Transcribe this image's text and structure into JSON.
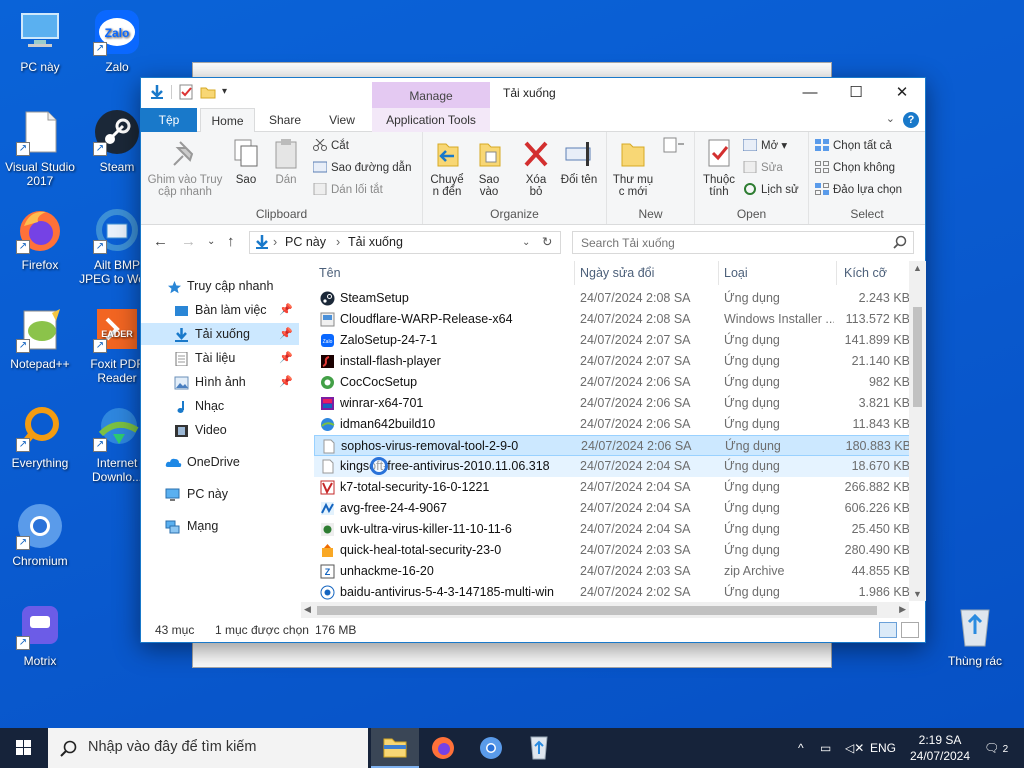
{
  "desktop": {
    "icons": [
      {
        "label": "PC này",
        "icon": "pc-icon"
      },
      {
        "label": "Zalo",
        "icon": "zalo-icon"
      },
      {
        "label": "Visual Studio 2017",
        "icon": "file-icon"
      },
      {
        "label": "Steam",
        "icon": "steam-icon"
      },
      {
        "label": "Firefox",
        "icon": "firefox-icon"
      },
      {
        "label": "Ailt BMP JPEG to Wo...",
        "icon": "converter-icon"
      },
      {
        "label": "Notepad++",
        "icon": "notepadpp-icon"
      },
      {
        "label": "Foxit PDF Reader",
        "icon": "foxit-icon"
      },
      {
        "label": "Everything",
        "icon": "everything-icon"
      },
      {
        "label": "Internet Downlo...",
        "icon": "idm-icon"
      },
      {
        "label": "Chromium",
        "icon": "chromium-icon"
      },
      {
        "label": "Motrix",
        "icon": "motrix-icon"
      },
      {
        "label": "Thùng rác",
        "icon": "recycle-bin-icon"
      }
    ]
  },
  "window": {
    "title": "Tải xuống",
    "manage_label": "Manage",
    "tabs": {
      "file": "Tệp",
      "home": "Home",
      "share": "Share",
      "view": "View",
      "app_tools": "Application Tools"
    },
    "ribbon": {
      "clipboard": {
        "pin": "Ghim vào Truy cập nhanh",
        "copy": "Sao",
        "paste": "Dán",
        "cut": "Cắt",
        "copy_path": "Sao đường dẫn",
        "paste_shortcut": "Dán lối tắt",
        "label": "Clipboard"
      },
      "organize": {
        "move": "Chuyể n đến",
        "copy_to": "Sao vào",
        "delete": "Xóa bỏ",
        "rename": "Đổi tên",
        "label": "Organize"
      },
      "new": {
        "folder": "Thư mụ c mới",
        "label": "New"
      },
      "open": {
        "properties": "Thuộc tính",
        "open": "Mở",
        "edit": "Sửa",
        "history": "Lịch sử",
        "label": "Open"
      },
      "select": {
        "all": "Chọn tất cả",
        "none": "Chọn không",
        "invert": "Đảo lựa chọn",
        "label": "Select"
      }
    },
    "address": {
      "crumbs": [
        "PC này",
        "Tải xuống"
      ],
      "search_placeholder": "Search Tải xuống"
    },
    "nav": [
      {
        "label": "Truy cập nhanh",
        "icon": "star-icon",
        "pinned": false
      },
      {
        "label": "Bàn làm việc",
        "icon": "desktop-icon",
        "pinned": true
      },
      {
        "label": "Tải xuống",
        "icon": "download-icon",
        "pinned": true
      },
      {
        "label": "Tài liệu",
        "icon": "document-icon",
        "pinned": true
      },
      {
        "label": "Hình ảnh",
        "icon": "picture-icon",
        "pinned": true
      },
      {
        "label": "Nhạc",
        "icon": "music-icon",
        "pinned": false
      },
      {
        "label": "Video",
        "icon": "video-icon",
        "pinned": false
      },
      {
        "label": "OneDrive",
        "icon": "cloud-icon",
        "pinned": false
      },
      {
        "label": "PC này",
        "icon": "pc-icon",
        "pinned": false
      },
      {
        "label": "Mạng",
        "icon": "network-icon",
        "pinned": false
      }
    ],
    "columns": {
      "name": "Tên",
      "date": "Ngày sửa đổi",
      "type": "Loại",
      "size": "Kích cỡ"
    },
    "files": [
      {
        "name": "SteamSetup",
        "date": "24/07/2024 2:08 SA",
        "type": "Ứng dụng",
        "size": "2.243 KB",
        "icon": "steam-icon"
      },
      {
        "name": "Cloudflare-WARP-Release-x64",
        "date": "24/07/2024 2:08 SA",
        "type": "Windows Installer ...",
        "size": "113.572 KB",
        "icon": "msi-icon"
      },
      {
        "name": "ZaloSetup-24-7-1",
        "date": "24/07/2024 2:07 SA",
        "type": "Ứng dụng",
        "size": "141.899 KB",
        "icon": "zalo-icon"
      },
      {
        "name": "install-flash-player",
        "date": "24/07/2024 2:07 SA",
        "type": "Ứng dụng",
        "size": "21.140 KB",
        "icon": "flash-icon"
      },
      {
        "name": "CocCocSetup",
        "date": "24/07/2024 2:06 SA",
        "type": "Ứng dụng",
        "size": "982 KB",
        "icon": "coccoc-icon"
      },
      {
        "name": "winrar-x64-701",
        "date": "24/07/2024 2:06 SA",
        "type": "Ứng dụng",
        "size": "3.821 KB",
        "icon": "winrar-icon"
      },
      {
        "name": "idman642build10",
        "date": "24/07/2024 2:06 SA",
        "type": "Ứng dụng",
        "size": "11.843 KB",
        "icon": "idm-icon"
      },
      {
        "name": "sophos-virus-removal-tool-2-9-0",
        "date": "24/07/2024 2:06 SA",
        "type": "Ứng dụng",
        "size": "180.883 KB",
        "icon": "file-icon"
      },
      {
        "name": "kingsoft-free-antivirus-2010.11.06.318",
        "date": "24/07/2024 2:04 SA",
        "type": "Ứng dụng",
        "size": "18.670 KB",
        "icon": "file-icon"
      },
      {
        "name": "k7-total-security-16-0-1221",
        "date": "24/07/2024 2:04 SA",
        "type": "Ứng dụng",
        "size": "266.882 KB",
        "icon": "k7-icon"
      },
      {
        "name": "avg-free-24-4-9067",
        "date": "24/07/2024 2:04 SA",
        "type": "Ứng dụng",
        "size": "606.226 KB",
        "icon": "avg-icon"
      },
      {
        "name": "uvk-ultra-virus-killer-11-10-11-6",
        "date": "24/07/2024 2:04 SA",
        "type": "Ứng dụng",
        "size": "25.450 KB",
        "icon": "uvk-icon"
      },
      {
        "name": "quick-heal-total-security-23-0",
        "date": "24/07/2024 2:03 SA",
        "type": "Ứng dụng",
        "size": "280.490 KB",
        "icon": "installer-icon"
      },
      {
        "name": "unhackme-16-20",
        "date": "24/07/2024 2:03 SA",
        "type": "zip Archive",
        "size": "44.855 KB",
        "icon": "zip-icon"
      },
      {
        "name": "baidu-antivirus-5-4-3-147185-multi-win",
        "date": "24/07/2024 2:02 SA",
        "type": "Ứng dụng",
        "size": "1.986 KB",
        "icon": "baidu-icon"
      }
    ],
    "status": {
      "count": "43 mục",
      "selected": "1 mục được chọn",
      "size": "176 MB"
    }
  },
  "taskbar": {
    "search_placeholder": "Nhập vào đây để tìm kiếm",
    "lang": "ENG",
    "time": "2:19 SA",
    "date": "24/07/2024",
    "notifications": "2"
  },
  "colors": {
    "accent": "#1979ca",
    "selection": "#cce8ff",
    "manage": "#e4c9f2",
    "desktop": "#0a5bd0"
  }
}
